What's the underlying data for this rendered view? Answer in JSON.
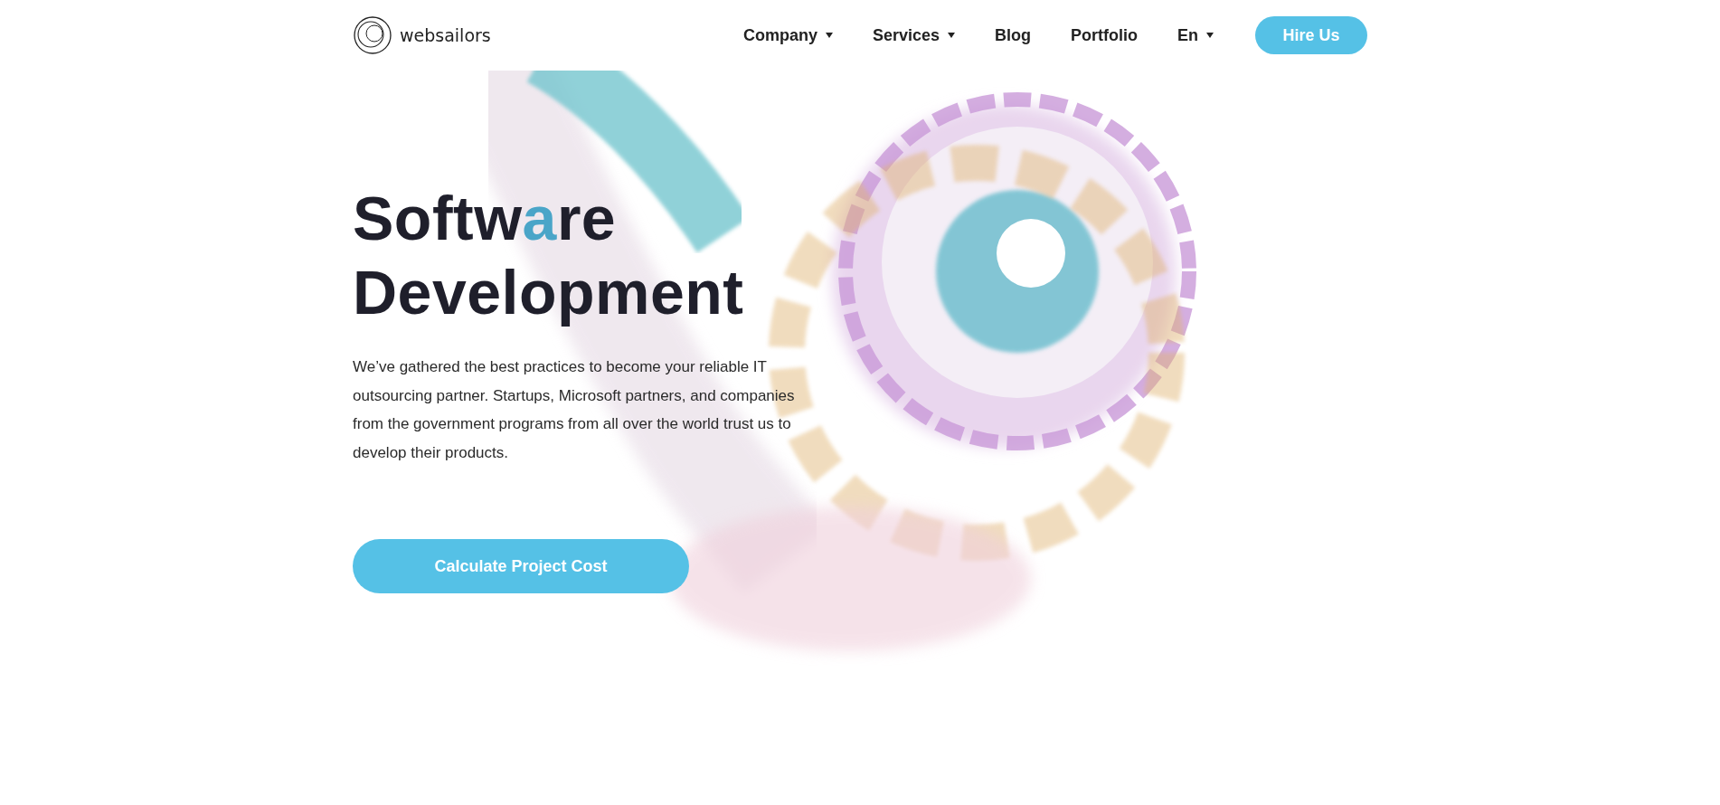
{
  "header": {
    "logo_text": "websailors",
    "nav": [
      {
        "label": "Company",
        "has_menu": true
      },
      {
        "label": "Services",
        "has_menu": true
      },
      {
        "label": "Blog",
        "has_menu": false
      },
      {
        "label": "Portfolio",
        "has_menu": false
      },
      {
        "label": "En",
        "has_menu": true
      }
    ],
    "cta": "Hire Us"
  },
  "hero": {
    "title_lines": [
      [
        {
          "text": "Softw",
          "accent": false
        },
        {
          "text": "a",
          "accent": true
        },
        {
          "text": "re",
          "accent": false
        }
      ],
      [
        {
          "text": "Development",
          "accent": false
        }
      ]
    ],
    "description": "We’ve gathered the best practices to become your reliable IT outsourcing partner. Startups, Microsoft partners, and companies from the government programs from all over the world trust us to develop their products.",
    "button": "Calculate Project Cost"
  }
}
